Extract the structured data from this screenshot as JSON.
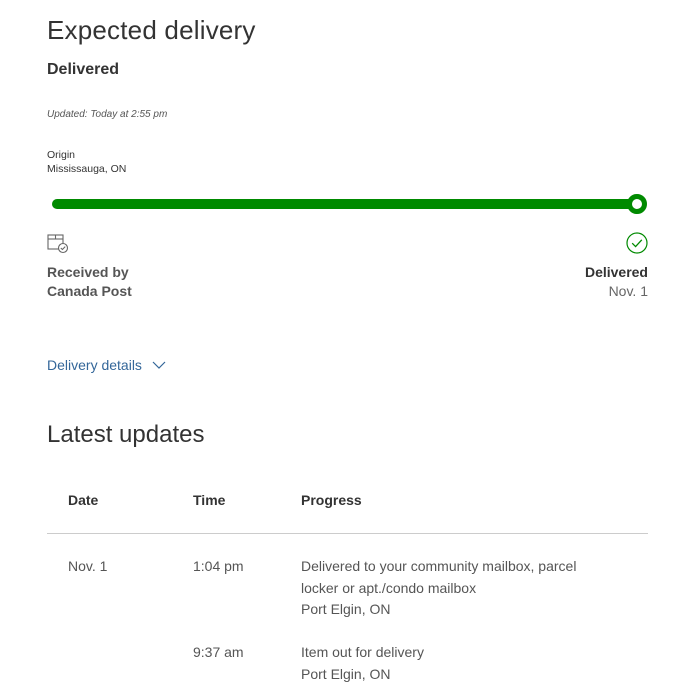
{
  "header": {
    "title": "Expected delivery",
    "status": "Delivered",
    "updated": "Updated: Today at 2:55 pm",
    "origin_label": "Origin",
    "origin_city": "Mississauga, ON"
  },
  "progress": {
    "percent": 100,
    "accent_color": "#008a00",
    "start_icon": "package-received-icon",
    "end_icon": "checkmark-circle-icon",
    "start_label_line1": "Received by",
    "start_label_line2": "Canada Post",
    "end_label": "Delivered",
    "end_date": "Nov. 1"
  },
  "details": {
    "label": "Delivery details",
    "icon": "chevron-down-icon"
  },
  "updates": {
    "title": "Latest updates",
    "columns": [
      "Date",
      "Time",
      "Progress"
    ],
    "rows": [
      {
        "date": "Nov. 1",
        "time": "1:04 pm",
        "progress_line1": "Delivered to your community mailbox, parcel",
        "progress_line2": "locker or apt./condo mailbox",
        "location": "Port Elgin, ON"
      },
      {
        "date": "",
        "time": "9:37 am",
        "progress_line1": "Item out for delivery",
        "progress_line2": "",
        "location": "Port Elgin, ON"
      }
    ]
  }
}
